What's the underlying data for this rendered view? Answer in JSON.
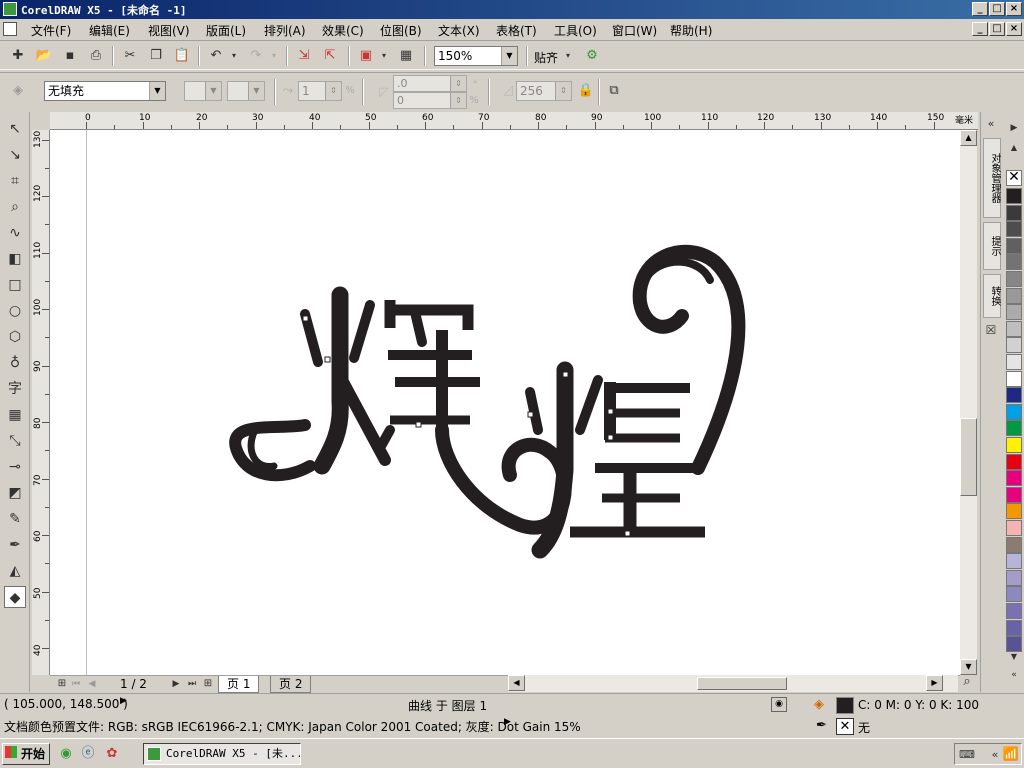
{
  "title": "CorelDRAW X5 - [未命名 -1]",
  "menu": [
    "文件(F)",
    "编辑(E)",
    "视图(V)",
    "版面(L)",
    "排列(A)",
    "效果(C)",
    "位图(B)",
    "文本(X)",
    "表格(T)",
    "工具(O)",
    "窗口(W)",
    "帮助(H)"
  ],
  "toolbar": {
    "zoom": "150%",
    "snap_label": "贴齐"
  },
  "propbar": {
    "fill": "无填充",
    "outline_count": "1",
    "angle1": ".0",
    "angle2": "0",
    "transparency": "256"
  },
  "ruler": {
    "unit": "毫米",
    "h_labels": [
      "0",
      "10",
      "20",
      "30",
      "40",
      "50",
      "60",
      "70",
      "80",
      "90",
      "100",
      "110",
      "120",
      "130",
      "140",
      "150"
    ],
    "v_labels": [
      "130",
      "120",
      "110",
      "100",
      "90",
      "80",
      "70",
      "60",
      "50",
      "40"
    ]
  },
  "artwork": {
    "text": "辉煌",
    "color": "#231f20"
  },
  "pagebar": {
    "page_counter": "1 / 2",
    "tabs": [
      "页 1",
      "页 2"
    ]
  },
  "dockers": [
    "对象管理器",
    "提示",
    "转换"
  ],
  "palette": [
    "#231f20",
    "#3a3a3a",
    "#4d4d4d",
    "#606060",
    "#737373",
    "#868686",
    "#999999",
    "#ababab",
    "#bebebe",
    "#d1d1d1",
    "#e4e4e4",
    "#ffffff",
    "#1e2a82",
    "#00a0e9",
    "#009944",
    "#fff100",
    "#e60012",
    "#e4007f",
    "#e60082",
    "#f39800",
    "#f5b4b2",
    "#8b7b73",
    "#b8b4d8",
    "#a69ccb",
    "#8c88c0",
    "#7b70b2",
    "#6a62a8",
    "#585298"
  ],
  "status": {
    "coords": "( 105.000, 148.500 )",
    "object": "曲线 于 图层 1",
    "fill_values": "C: 0 M: 0 Y: 0 K: 100",
    "profile": "文档颜色预置文件: RGB: sRGB IEC61966-2.1; CMYK: Japan Color 2001 Coated; 灰度: Dot Gain 15%",
    "outline": "无"
  },
  "taskbar": {
    "start": "开始",
    "task": "CorelDRAW X5 - [未..."
  }
}
